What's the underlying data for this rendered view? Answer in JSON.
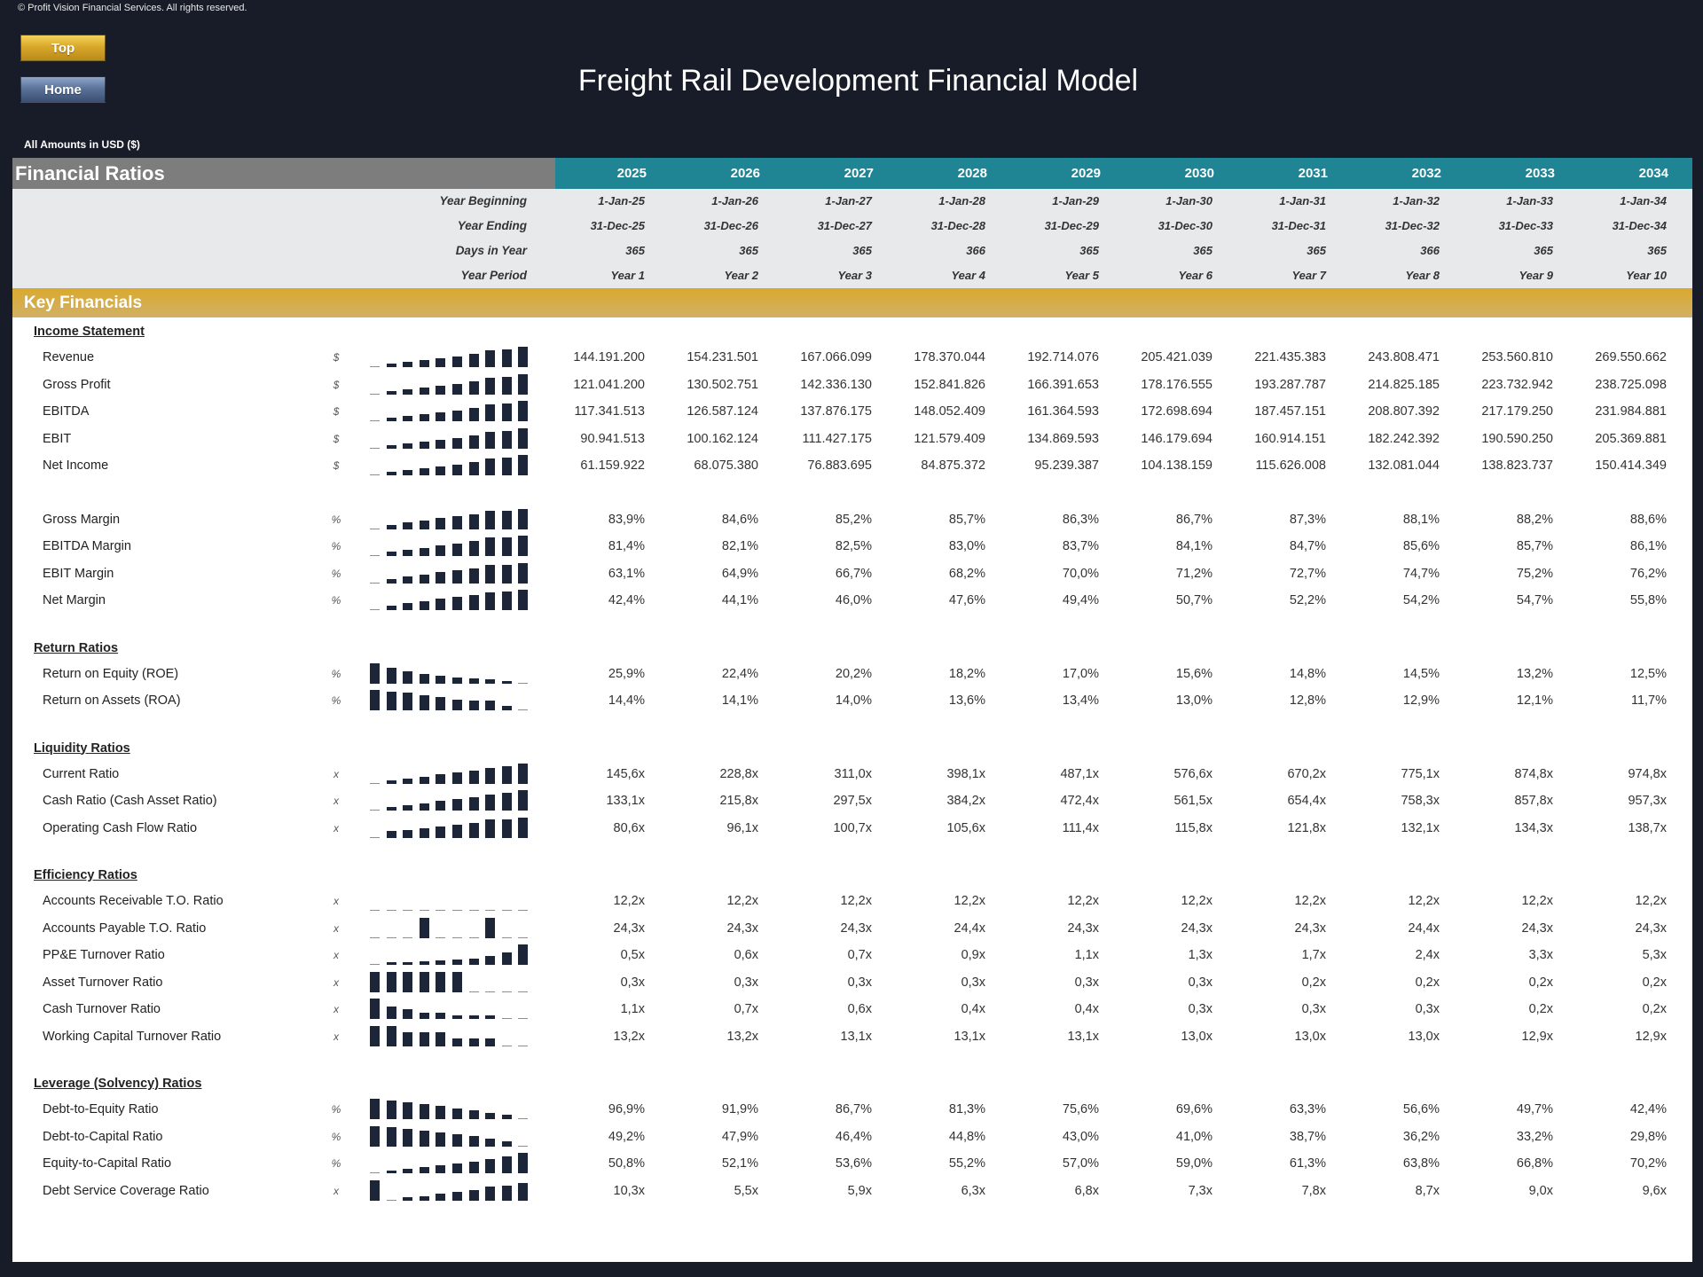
{
  "header": {
    "copyright": "© Profit Vision Financial Services. All rights reserved.",
    "buttons": {
      "top": "Top",
      "home": "Home"
    },
    "title": "Freight Rail Development Financial Model",
    "amounts_note": "All Amounts in  USD ($)"
  },
  "colors": {
    "background": "#171c28",
    "header_gray": "#7d7d7d",
    "header_teal": "#1f8595",
    "band_gold": "#d9a92e",
    "spark_bar": "#1d2638"
  },
  "sheet": {
    "title": "Financial Ratios",
    "years": [
      "2025",
      "2026",
      "2027",
      "2028",
      "2029",
      "2030",
      "2031",
      "2032",
      "2033",
      "2034"
    ],
    "meta": [
      {
        "label": "Year Beginning",
        "values": [
          "1-Jan-25",
          "1-Jan-26",
          "1-Jan-27",
          "1-Jan-28",
          "1-Jan-29",
          "1-Jan-30",
          "1-Jan-31",
          "1-Jan-32",
          "1-Jan-33",
          "1-Jan-34"
        ]
      },
      {
        "label": "Year Ending",
        "values": [
          "31-Dec-25",
          "31-Dec-26",
          "31-Dec-27",
          "31-Dec-28",
          "31-Dec-29",
          "31-Dec-30",
          "31-Dec-31",
          "31-Dec-32",
          "31-Dec-33",
          "31-Dec-34"
        ]
      },
      {
        "label": "Days in Year",
        "values": [
          "365",
          "365",
          "365",
          "366",
          "365",
          "365",
          "365",
          "366",
          "365",
          "365"
        ]
      },
      {
        "label": "Year Period",
        "values": [
          "Year 1",
          "Year 2",
          "Year 3",
          "Year 4",
          "Year 5",
          "Year 6",
          "Year 7",
          "Year 8",
          "Year 9",
          "Year 10"
        ]
      }
    ],
    "band_title": "Key Financials",
    "sections": [
      {
        "title": "Income Statement",
        "groups": [
          [
            {
              "label": "Revenue",
              "unit": "$",
              "values": [
                "144.191.200",
                "154.231.501",
                "167.066.099",
                "178.370.044",
                "192.714.076",
                "205.421.039",
                "221.435.383",
                "243.808.471",
                "253.560.810",
                "269.550.662"
              ]
            },
            {
              "label": "Gross Profit",
              "unit": "$",
              "values": [
                "121.041.200",
                "130.502.751",
                "142.336.130",
                "152.841.826",
                "166.391.653",
                "178.176.555",
                "193.287.787",
                "214.825.185",
                "223.732.942",
                "238.725.098"
              ]
            },
            {
              "label": "EBITDA",
              "unit": "$",
              "values": [
                "117.341.513",
                "126.587.124",
                "137.876.175",
                "148.052.409",
                "161.364.593",
                "172.698.694",
                "187.457.151",
                "208.807.392",
                "217.179.250",
                "231.984.881"
              ]
            },
            {
              "label": "EBIT",
              "unit": "$",
              "values": [
                "90.941.513",
                "100.162.124",
                "111.427.175",
                "121.579.409",
                "134.869.593",
                "146.179.694",
                "160.914.151",
                "182.242.392",
                "190.590.250",
                "205.369.881"
              ]
            },
            {
              "label": "Net Income",
              "unit": "$",
              "values": [
                "61.159.922",
                "68.075.380",
                "76.883.695",
                "84.875.372",
                "95.239.387",
                "104.138.159",
                "115.626.008",
                "132.081.044",
                "138.823.737",
                "150.414.349"
              ]
            }
          ],
          [
            {
              "label": "Gross Margin",
              "unit": "%",
              "values": [
                "83,9%",
                "84,6%",
                "85,2%",
                "85,7%",
                "86,3%",
                "86,7%",
                "87,3%",
                "88,1%",
                "88,2%",
                "88,6%"
              ]
            },
            {
              "label": "EBITDA Margin",
              "unit": "%",
              "values": [
                "81,4%",
                "82,1%",
                "82,5%",
                "83,0%",
                "83,7%",
                "84,1%",
                "84,7%",
                "85,6%",
                "85,7%",
                "86,1%"
              ]
            },
            {
              "label": "EBIT Margin",
              "unit": "%",
              "values": [
                "63,1%",
                "64,9%",
                "66,7%",
                "68,2%",
                "70,0%",
                "71,2%",
                "72,7%",
                "74,7%",
                "75,2%",
                "76,2%"
              ]
            },
            {
              "label": "Net Margin",
              "unit": "%",
              "values": [
                "42,4%",
                "44,1%",
                "46,0%",
                "47,6%",
                "49,4%",
                "50,7%",
                "52,2%",
                "54,2%",
                "54,7%",
                "55,8%"
              ]
            }
          ]
        ]
      },
      {
        "title": "Return Ratios",
        "groups": [
          [
            {
              "label": "Return on Equity (ROE)",
              "unit": "%",
              "values": [
                "25,9%",
                "22,4%",
                "20,2%",
                "18,2%",
                "17,0%",
                "15,6%",
                "14,8%",
                "14,5%",
                "13,2%",
                "12,5%"
              ]
            },
            {
              "label": "Return on Assets (ROA)",
              "unit": "%",
              "values": [
                "14,4%",
                "14,1%",
                "14,0%",
                "13,6%",
                "13,4%",
                "13,0%",
                "12,8%",
                "12,9%",
                "12,1%",
                "11,7%"
              ]
            }
          ]
        ]
      },
      {
        "title": "Liquidity Ratios",
        "groups": [
          [
            {
              "label": "Current Ratio",
              "unit": "x",
              "values": [
                "145,6x",
                "228,8x",
                "311,0x",
                "398,1x",
                "487,1x",
                "576,6x",
                "670,2x",
                "775,1x",
                "874,8x",
                "974,8x"
              ]
            },
            {
              "label": "Cash Ratio (Cash Asset Ratio)",
              "unit": "x",
              "values": [
                "133,1x",
                "215,8x",
                "297,5x",
                "384,2x",
                "472,4x",
                "561,5x",
                "654,4x",
                "758,3x",
                "857,8x",
                "957,3x"
              ]
            },
            {
              "label": "Operating Cash Flow Ratio",
              "unit": "x",
              "values": [
                "80,6x",
                "96,1x",
                "100,7x",
                "105,6x",
                "111,4x",
                "115,8x",
                "121,8x",
                "132,1x",
                "134,3x",
                "138,7x"
              ]
            }
          ]
        ]
      },
      {
        "title": "Efficiency Ratios",
        "groups": [
          [
            {
              "label": "Accounts Receivable T.O. Ratio",
              "unit": "x",
              "values": [
                "12,2x",
                "12,2x",
                "12,2x",
                "12,2x",
                "12,2x",
                "12,2x",
                "12,2x",
                "12,2x",
                "12,2x",
                "12,2x"
              ]
            },
            {
              "label": "Accounts Payable T.O. Ratio",
              "unit": "x",
              "values": [
                "24,3x",
                "24,3x",
                "24,3x",
                "24,4x",
                "24,3x",
                "24,3x",
                "24,3x",
                "24,4x",
                "24,3x",
                "24,3x"
              ]
            },
            {
              "label": "PP&E Turnover Ratio",
              "unit": "x",
              "values": [
                "0,5x",
                "0,6x",
                "0,7x",
                "0,9x",
                "1,1x",
                "1,3x",
                "1,7x",
                "2,4x",
                "3,3x",
                "5,3x"
              ]
            },
            {
              "label": "Asset Turnover Ratio",
              "unit": "x",
              "values": [
                "0,3x",
                "0,3x",
                "0,3x",
                "0,3x",
                "0,3x",
                "0,3x",
                "0,2x",
                "0,2x",
                "0,2x",
                "0,2x"
              ]
            },
            {
              "label": "Cash Turnover Ratio",
              "unit": "x",
              "values": [
                "1,1x",
                "0,7x",
                "0,6x",
                "0,4x",
                "0,4x",
                "0,3x",
                "0,3x",
                "0,3x",
                "0,2x",
                "0,2x"
              ]
            },
            {
              "label": "Working Capital Turnover Ratio",
              "unit": "x",
              "values": [
                "13,2x",
                "13,2x",
                "13,1x",
                "13,1x",
                "13,1x",
                "13,0x",
                "13,0x",
                "13,0x",
                "12,9x",
                "12,9x"
              ]
            }
          ]
        ]
      },
      {
        "title": "Leverage (Solvency) Ratios",
        "groups": [
          [
            {
              "label": "Debt-to-Equity Ratio",
              "unit": "%",
              "values": [
                "96,9%",
                "91,9%",
                "86,7%",
                "81,3%",
                "75,6%",
                "69,6%",
                "63,3%",
                "56,6%",
                "49,7%",
                "42,4%"
              ]
            },
            {
              "label": "Debt-to-Capital Ratio",
              "unit": "%",
              "values": [
                "49,2%",
                "47,9%",
                "46,4%",
                "44,8%",
                "43,0%",
                "41,0%",
                "38,7%",
                "36,2%",
                "33,2%",
                "29,8%"
              ]
            },
            {
              "label": "Equity-to-Capital Ratio",
              "unit": "%",
              "values": [
                "50,8%",
                "52,1%",
                "53,6%",
                "55,2%",
                "57,0%",
                "59,0%",
                "61,3%",
                "63,8%",
                "66,8%",
                "70,2%"
              ]
            },
            {
              "label": "Debt Service Coverage Ratio",
              "unit": "x",
              "values": [
                "10,3x",
                "5,5x",
                "5,9x",
                "6,3x",
                "6,8x",
                "7,3x",
                "7,8x",
                "8,7x",
                "9,0x",
                "9,6x"
              ]
            }
          ]
        ]
      }
    ]
  }
}
